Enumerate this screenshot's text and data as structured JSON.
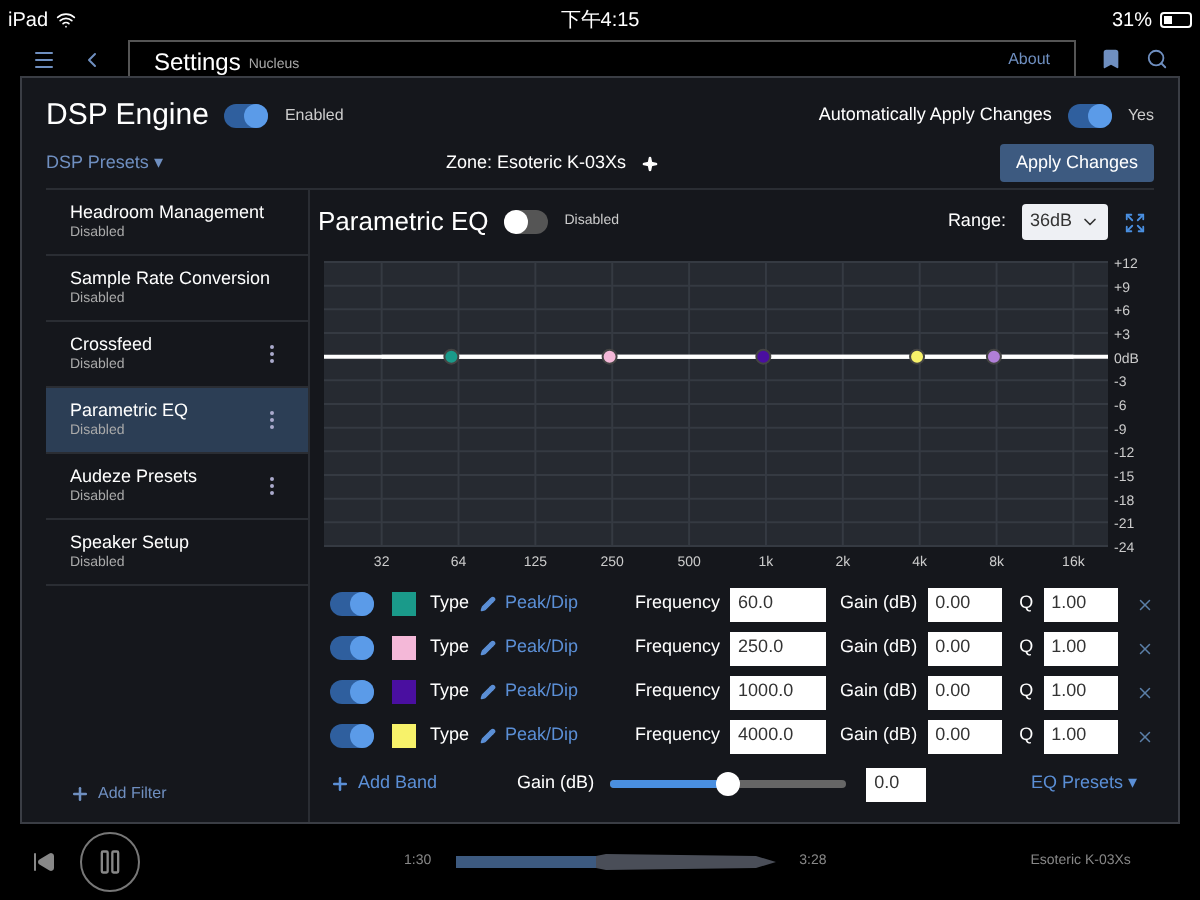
{
  "status_bar": {
    "device": "iPad",
    "time": "下午4:15",
    "battery": "31%"
  },
  "header": {
    "title": "Settings",
    "subtitle": "Nucleus",
    "link": "About"
  },
  "dsp": {
    "title": "DSP Engine",
    "enabled": {
      "on": true,
      "label": "Enabled"
    },
    "auto_apply": {
      "label": "Automatically Apply Changes",
      "on": true,
      "state_label": "Yes"
    },
    "presets": "DSP Presets ▾",
    "zone": "Zone: Esoteric K-03Xs",
    "apply_button": "Apply Changes"
  },
  "sidebar": {
    "items": [
      {
        "name": "Headroom Management",
        "status": "Disabled",
        "selected": false,
        "menu": false
      },
      {
        "name": "Sample Rate Conversion",
        "status": "Disabled",
        "selected": false,
        "menu": false
      },
      {
        "name": "Crossfeed",
        "status": "Disabled",
        "selected": false,
        "menu": true
      },
      {
        "name": "Parametric EQ",
        "status": "Disabled",
        "selected": true,
        "menu": true
      },
      {
        "name": "Audeze Presets",
        "status": "Disabled",
        "selected": false,
        "menu": true
      },
      {
        "name": "Speaker Setup",
        "status": "Disabled",
        "selected": false,
        "menu": false
      }
    ],
    "add": "Add Filter"
  },
  "eq": {
    "title": "Parametric EQ",
    "toggle": {
      "on": false,
      "label": "Disabled"
    },
    "range_label": "Range:",
    "range_value": "36dB",
    "chart_data": {
      "type": "line",
      "categories": [
        "32",
        "64",
        "125",
        "250",
        "500",
        "1k",
        "2k",
        "4k",
        "8k",
        "16k"
      ],
      "series": [
        {
          "color": "#ffffff",
          "values": [
            0,
            0,
            0,
            0,
            0,
            0,
            0,
            0,
            0,
            0
          ]
        }
      ],
      "ylim": [
        -24,
        12
      ],
      "grid": true,
      "yticks": [
        {
          "value": 12,
          "label": "+12"
        },
        {
          "value": 9,
          "label": "+9"
        },
        {
          "value": 6,
          "label": "+6"
        },
        {
          "value": 3,
          "label": "+3"
        },
        {
          "value": 0,
          "label": "0dB"
        },
        {
          "value": -3,
          "label": "-3"
        },
        {
          "value": -6,
          "label": "-6"
        },
        {
          "value": -9,
          "label": "-9"
        },
        {
          "value": -12,
          "label": "-12"
        },
        {
          "value": -15,
          "label": "-15"
        },
        {
          "value": -18,
          "label": "-18"
        },
        {
          "value": -21,
          "label": "-21"
        },
        {
          "value": -24,
          "label": "-24"
        }
      ]
    },
    "handles": [
      {
        "color": "#1a9a8a"
      },
      {
        "color": "#f4b8d8"
      },
      {
        "color": "#4a0fa0"
      },
      {
        "color": "#f7f26a"
      },
      {
        "color": "#b07fd8"
      }
    ],
    "bands": [
      {
        "on": true,
        "color": "#1a9a8a",
        "type_label": "Type",
        "type": "Peak/Dip",
        "freq_label": "Frequency",
        "freq": "60.0",
        "gain_label": "Gain (dB)",
        "gain": "0.00",
        "q_label": "Q",
        "q": "1.00"
      },
      {
        "on": true,
        "color": "#f4b8d8",
        "type_label": "Type",
        "type": "Peak/Dip",
        "freq_label": "Frequency",
        "freq": "250.0",
        "gain_label": "Gain (dB)",
        "gain": "0.00",
        "q_label": "Q",
        "q": "1.00"
      },
      {
        "on": true,
        "color": "#4a0fa0",
        "type_label": "Type",
        "type": "Peak/Dip",
        "freq_label": "Frequency",
        "freq": "1000.0",
        "gain_label": "Gain (dB)",
        "gain": "0.00",
        "q_label": "Q",
        "q": "1.00"
      },
      {
        "on": true,
        "color": "#f7f26a",
        "type_label": "Type",
        "type": "Peak/Dip",
        "freq_label": "Frequency",
        "freq": "4000.0",
        "gain_label": "Gain (dB)",
        "gain": "0.00",
        "q_label": "Q",
        "q": "1.00"
      }
    ],
    "add_band": "Add Band",
    "gain_label": "Gain (dB)",
    "gain_slider": {
      "level": 0.5
    },
    "gain_value": "0.0",
    "presets": "EQ Presets ▾"
  },
  "player": {
    "elapsed": "1:30",
    "total": "3:28",
    "zone": "Esoteric K-03Xs"
  }
}
